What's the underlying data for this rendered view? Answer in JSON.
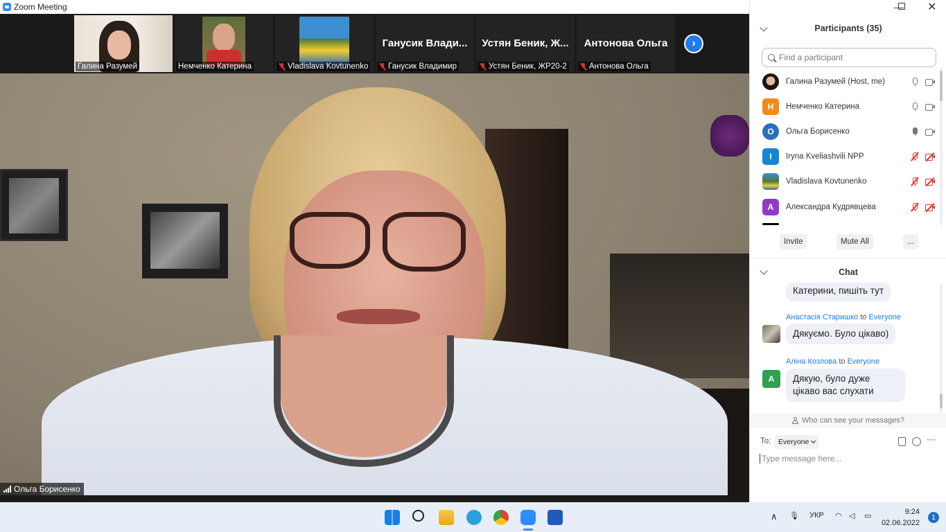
{
  "window": {
    "title": "Zoom Meeting"
  },
  "thumbnails": [
    {
      "label": "Галина Разумей",
      "muted": false,
      "type": "video"
    },
    {
      "label": "Немченко Катерина",
      "muted": false,
      "type": "video"
    },
    {
      "label": "Vladislava Kovtunenko",
      "muted": true,
      "type": "photo"
    },
    {
      "label": "Ганусик Владимир",
      "display": "Ганусик Влади...",
      "muted": true,
      "type": "name"
    },
    {
      "label": "Устян Беник, ЖР20-2",
      "display": "Устян Беник, Ж...",
      "muted": true,
      "type": "name"
    },
    {
      "label": "Антонова Ольга",
      "display": "Антонова Ольга",
      "muted": true,
      "type": "name"
    }
  ],
  "main": {
    "speaker": "Ольга Борисенко"
  },
  "participants": {
    "title": "Participants (35)",
    "search_placeholder": "Find a participant",
    "list": [
      {
        "name": "Галина Разумей (Host, me)",
        "initial": "",
        "color": "#000000",
        "mic": "on",
        "cam": "on"
      },
      {
        "name": "Немченко Катерина",
        "initial": "Н",
        "color": "#f28a1b",
        "mic": "on",
        "cam": "on"
      },
      {
        "name": "Ольга Борисенко",
        "initial": "О",
        "color": "#2a6fbf",
        "mic": "active",
        "cam": "on"
      },
      {
        "name": "Iryna Kveliashvili NPP",
        "initial": "I",
        "color": "#1486d6",
        "mic": "off",
        "cam": "off"
      },
      {
        "name": "Vladislava Kovtunenko",
        "initial": "",
        "color": "#3a6ea5",
        "mic": "off",
        "cam": "off"
      },
      {
        "name": "Александра Кудрявцева",
        "initial": "А",
        "color": "#8e3cc7",
        "mic": "off",
        "cam": "off"
      }
    ],
    "buttons": {
      "invite": "Invite",
      "mute_all": "Mute All",
      "more": "..."
    }
  },
  "chat": {
    "title": "Chat",
    "messages": [
      {
        "sender": "",
        "to": "",
        "text": "Катерини, пишіть тут"
      },
      {
        "sender": "Анастасія Старишко",
        "to_word": "to",
        "to": "Everyone",
        "text": "Дякуємо. Було цікаво)"
      },
      {
        "sender": "Аліна Козлова",
        "to_word": "to",
        "to": "Everyone",
        "text": "Дякую, було дуже цікаво вас слухати",
        "initial": "А"
      }
    ],
    "who_can_see": "Who can see your messages?",
    "to_label": "To:",
    "to_value": "Everyone",
    "placeholder": "Type message here..."
  },
  "taskbar": {
    "lang": "УКР",
    "time": "9:24",
    "date": "02.06.2022",
    "notifications": "1"
  },
  "colors": {
    "accent": "#1f7aec",
    "muted": "#e02f2f",
    "panel_bg": "#ffffff"
  }
}
